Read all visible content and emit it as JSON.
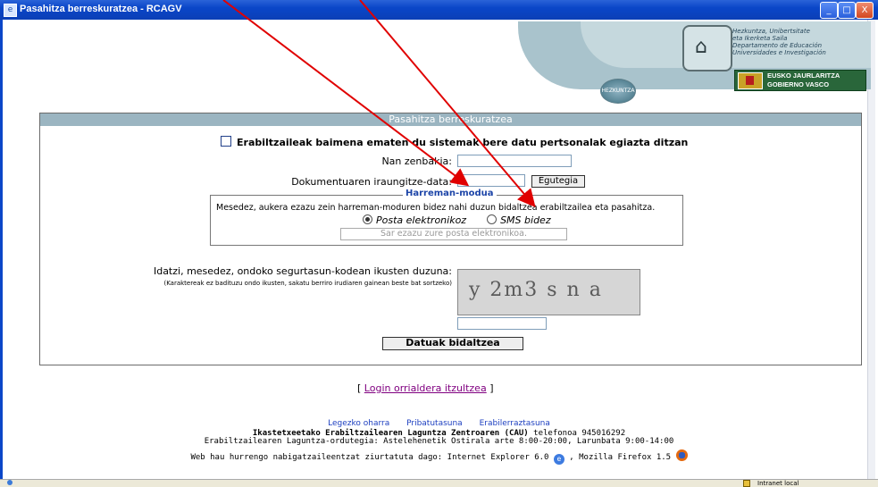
{
  "window": {
    "title": "Pasahitza berreskuratzea - RCAGV",
    "minimize_glyph": "_",
    "maximize_glyph": "□",
    "close_glyph": "X"
  },
  "header": {
    "dept_lines": [
      "Hezkuntza, Unibertsitate",
      "eta Ikerketa Saila",
      "Departamento de Educación",
      "Universidades e Investigación"
    ],
    "badge": "HEZKUNTZA",
    "gov_line1": "EUSKO JAURLARITZA",
    "gov_line2": "GOBIERNO VASCO"
  },
  "form": {
    "heading": "Pasahitza berreskuratzea",
    "consent_label": "Erabiltzaileak baimena ematen du sistemak bere datu pertsonalak egiazta ditzan",
    "nan_label": "Nan zenbakia:",
    "nan_value": "",
    "date_label": "Dokumentuaren iraungitze-data:",
    "date_value": "",
    "calendar_button": "Egutegia",
    "contact": {
      "legend": "Harreman-modua",
      "description": "Mesedez, aukera ezazu zein harreman-moduren bidez nahi duzun bidaltzea erabiltzailea eta pasahitza.",
      "option_email": "Posta elektronikoz",
      "option_sms": "SMS bidez",
      "selected": "Posta elektronikoz",
      "email_placeholder": "Sar ezazu zure posta elektronikoa."
    },
    "captcha_label": "Idatzi, mesedez, ondoko segurtasun-kodean ikusten duzuna:",
    "captcha_hint": "(Karaktereak ez badituzu ondo ikusten, sakatu berriro irudiaren gainean beste bat sortzeko)",
    "captcha_text": "y 2m3 s n a",
    "captcha_value": "",
    "submit_button": "Datuak bidaltzea"
  },
  "login_link": {
    "open": "[",
    "label": "Login orrialdera itzultzea",
    "close": "]"
  },
  "footer": {
    "links": [
      "Legezko oharra",
      "Pribatutasuna",
      "Erabilerraztasuna"
    ],
    "cau_bold": "Ikastetxeetako Erabiltzailearen Laguntza Zentroaren (CAU)",
    "cau_phone": "telefonoa 945016292",
    "hours": "Erabiltzailearen Laguntza-ordutegia: Astelehenetik Ostirala arte 8:00-20:00, Larunbata 9:00-14:00",
    "browsers_prefix": "Web hau hurrengo nabigatzaileentzat ziurtatuta dago:",
    "browser_ie": "Internet Explorer 6.0",
    "browser_ff": ", Mozilla Firefox 1.5"
  },
  "statusbar": {
    "zone": "Intranet local"
  },
  "colors": {
    "titlebar": "#0a46c8",
    "form_header": "#9bb5c1",
    "legend": "#1d45a8",
    "link_visited": "#800080",
    "footer_link": "#1d3fc0",
    "annotation_arrow": "#e00000"
  }
}
